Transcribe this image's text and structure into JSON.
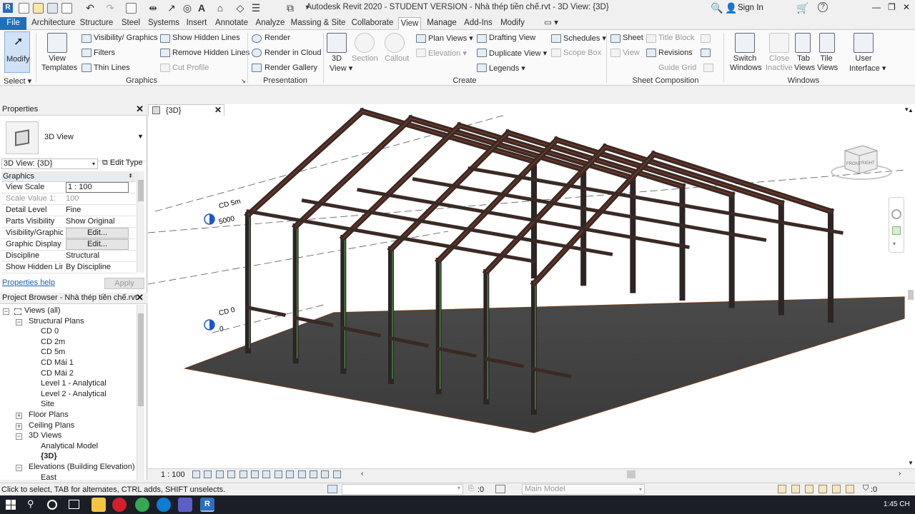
{
  "window": {
    "title": "Autodesk Revit 2020 - STUDENT VERSION - Nhà thép tiền chế.rvt - 3D View: {3D}",
    "sign_in": "Sign In",
    "win_controls": [
      "—",
      "❐",
      "✕"
    ]
  },
  "menu": {
    "tabs": [
      "File",
      "Architecture",
      "Structure",
      "Steel",
      "Systems",
      "Insert",
      "Annotate",
      "Analyze",
      "Massing & Site",
      "Collaborate",
      "View",
      "Manage",
      "Add-Ins",
      "Modify"
    ],
    "active": "View"
  },
  "ribbon": {
    "modify": "Modify",
    "select": "Select",
    "view_templates_1": "View",
    "view_templates_2": "Templates",
    "visibility_graphics": "Visibility/ Graphics",
    "filters": "Filters",
    "thin_lines": "Thin  Lines",
    "show_hidden_lines": "Show  Hidden Lines",
    "remove_hidden_lines": "Remove  Hidden Lines",
    "cut_profile": "Cut  Profile",
    "render": "Render",
    "render_in_cloud": "Render  in Cloud",
    "render_gallery": "Render  Gallery",
    "view_3d_1": "3D",
    "view_3d_2": "View",
    "section": "Section",
    "callout": "Callout",
    "plan_views": "Plan  Views",
    "elevation": "Elevation",
    "drafting_view": "Drafting  View",
    "duplicate_view": "Duplicate  View",
    "legends": "Legends",
    "schedules": "Schedules",
    "scope_box": "Scope  Box",
    "sheet": "Sheet",
    "view": "View",
    "title_block": "Title  Block",
    "revisions": "Revisions",
    "guide_grid": "Guide  Grid",
    "switch_windows_1": "Switch",
    "switch_windows_2": "Windows",
    "close_inactive_1": "Close",
    "close_inactive_2": "Inactive",
    "tab_views_1": "Tab",
    "tab_views_2": "Views",
    "tile_views_1": "Tile",
    "tile_views_2": "Views",
    "user_interface_1": "User",
    "user_interface_2": "Interface",
    "panels": {
      "graphics": "Graphics",
      "presentation": "Presentation",
      "create": "Create",
      "sheet_composition": "Sheet Composition",
      "windows": "Windows"
    }
  },
  "properties": {
    "header": "Properties",
    "type_name": "3D View",
    "instance_selector": "3D View: {3D}",
    "edit_type": "Edit Type",
    "group": "Graphics",
    "rows": [
      {
        "k": "View Scale",
        "v": "1 : 100"
      },
      {
        "k": "Scale Value    1:",
        "v": "100"
      },
      {
        "k": "Detail Level",
        "v": "Fine"
      },
      {
        "k": "Parts Visibility",
        "v": "Show Original"
      },
      {
        "k": "Visibility/Graphic...",
        "v": "Edit..."
      },
      {
        "k": "Graphic Display ...",
        "v": "Edit..."
      },
      {
        "k": "Discipline",
        "v": "Structural"
      },
      {
        "k": "Show Hidden Lin...",
        "v": "By Discipline"
      }
    ],
    "help_link": "Properties help",
    "apply": "Apply"
  },
  "browser": {
    "header": "Project Browser - Nhà thép tiền chế.rvt",
    "items": [
      {
        "label": "Views (all)",
        "level": 0,
        "exp": "−"
      },
      {
        "label": "Structural Plans",
        "level": 1,
        "exp": "−"
      },
      {
        "label": "CD 0",
        "level": 2,
        "exp": ""
      },
      {
        "label": "CD 2m",
        "level": 2,
        "exp": ""
      },
      {
        "label": "CD 5m",
        "level": 2,
        "exp": ""
      },
      {
        "label": "CD Mái 1",
        "level": 2,
        "exp": ""
      },
      {
        "label": "CD Mái 2",
        "level": 2,
        "exp": ""
      },
      {
        "label": "Level 1 - Analytical",
        "level": 2,
        "exp": ""
      },
      {
        "label": "Level 2 - Analytical",
        "level": 2,
        "exp": ""
      },
      {
        "label": "Site",
        "level": 2,
        "exp": ""
      },
      {
        "label": "Floor Plans",
        "level": 1,
        "exp": "+"
      },
      {
        "label": "Ceiling Plans",
        "level": 1,
        "exp": "+"
      },
      {
        "label": "3D Views",
        "level": 1,
        "exp": "−"
      },
      {
        "label": "Analytical Model",
        "level": 2,
        "exp": ""
      },
      {
        "label": "{3D}",
        "level": 2,
        "exp": ""
      },
      {
        "label": "Elevations (Building Elevation)",
        "level": 1,
        "exp": "−"
      },
      {
        "label": "East",
        "level": 2,
        "exp": ""
      }
    ]
  },
  "view": {
    "tab_label": "{3D}",
    "scale": "1 : 100",
    "level_top_name": "CD 5m",
    "level_top_value": "5000",
    "level_bottom_name": "CD 0",
    "level_bottom_value": "0",
    "viewcube_front": "FRONT",
    "viewcube_right": "RIGHT"
  },
  "status": {
    "message": "Click to select, TAB for alternates, CTRL adds, SHIFT unselects.",
    "count": ":0",
    "model": "Main Model",
    "filter_count": ":0"
  },
  "taskbar": {
    "clock": "1:45 CH"
  }
}
